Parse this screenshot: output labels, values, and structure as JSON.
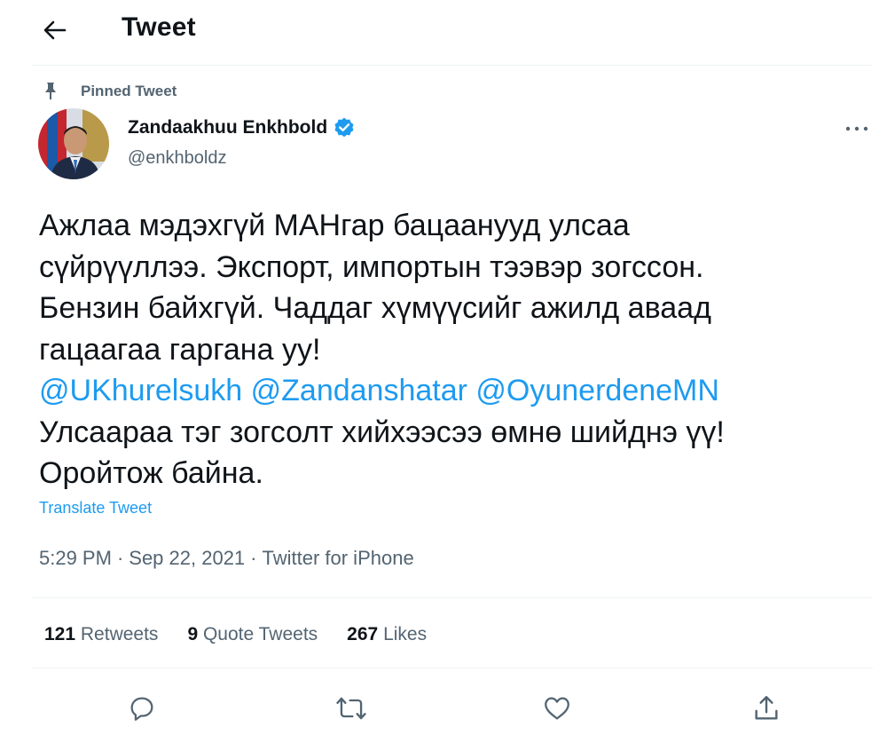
{
  "header": {
    "title": "Tweet",
    "back_icon": "arrow-left-icon"
  },
  "pinned": {
    "label": "Pinned Tweet",
    "icon": "pin-icon"
  },
  "author": {
    "name": "Zandaakhuu Enkhbold",
    "handle": "@enkhboldz",
    "verified_color": "#1d9bf0"
  },
  "tweet": {
    "lines": [
      "Ажлаа мэдэхгүй МАНгар бацаанууд улсаа",
      "сүйрүүллээ. Экспорт, импортын тээвэр зогссон.",
      "Бензин байхгүй. Чаддаг хүмүүсийг ажилд аваад",
      "гацаагаа гаргана уу!"
    ],
    "mentions": [
      "@UKhurelsukh",
      "@Zandanshatar",
      "@OyunerdeneMN"
    ],
    "lines_after": [
      "Улсаараа тэг зогсолт хийхээсээ өмнө шийднэ үү!",
      "Оройтож байна."
    ],
    "translate_label": "Translate Tweet"
  },
  "meta": {
    "time": "5:29 PM",
    "date": "Sep 22, 2021",
    "source": "Twitter for iPhone",
    "separator": "·"
  },
  "stats": {
    "retweets_count": "121",
    "retweets_label": "Retweets",
    "quotes_count": "9",
    "quotes_label": "Quote Tweets",
    "likes_count": "267",
    "likes_label": "Likes"
  },
  "actions": [
    "reply-icon",
    "retweet-icon",
    "like-icon",
    "share-icon"
  ],
  "colors": {
    "accent": "#1d9bf0",
    "secondary_text": "#536471",
    "primary_text": "#0f1419"
  }
}
